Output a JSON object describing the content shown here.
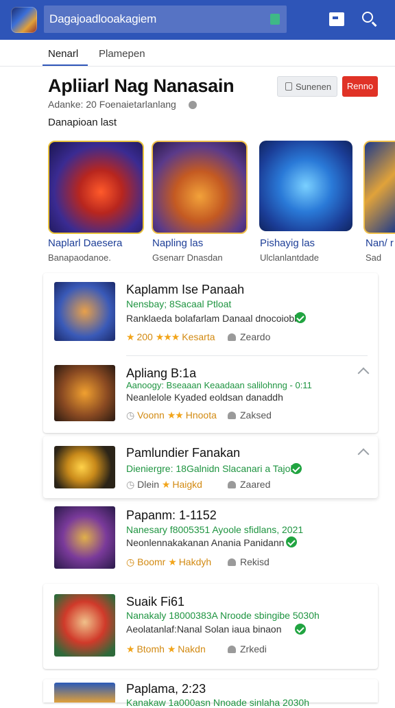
{
  "header": {
    "search_text": "Dagajoadlooakagiem",
    "icons": [
      "app-logo",
      "bookmark-icon",
      "search-icon"
    ]
  },
  "tabs": [
    {
      "label": "Nenarl",
      "active": true
    },
    {
      "label": "Plamepen",
      "active": false
    }
  ],
  "page": {
    "title": "Apliiarl Nag Nanasain",
    "subline": "Adanke: 20  Foenaietarlanlang",
    "subscribe_label": "Sunenen",
    "action_label": "Renno",
    "section_label": "Danapioan last"
  },
  "featured": [
    {
      "title": "Naplarl Daesera",
      "subtitle": "Banapaodanoe."
    },
    {
      "title": "Napling las",
      "subtitle": "Gsenarr Dnasdan"
    },
    {
      "title": "Pishayig las",
      "subtitle": "Ulclanlantdade"
    },
    {
      "title": "Nan/ r",
      "subtitle": "Sad"
    }
  ],
  "list": [
    {
      "title": "Kaplamm Ise Panaah",
      "green": "Nensbay; 8Sacaal Ptloat",
      "desc": "Ranklaeda bolafarlam Danaal dnocoiobb",
      "rating": "200",
      "rating_label": "Kesarta",
      "likes": "Zeardo"
    },
    {
      "title": "Apliang B:1a",
      "green": "Aanoogy: Bseaaan Keaadaan salilohnng - 0:11",
      "desc": "Neanlelole Kyaded eoldsan danaddh",
      "rating": "Voonn",
      "rating_label": "Hnoota",
      "likes": "Zaksed"
    },
    {
      "title": "Pamlundier Fanakan",
      "green": "Dieniergre: 18Galnidn Slacanari a Tajol",
      "desc": "",
      "rating": "Dlein",
      "rating_label": "Haigkd",
      "likes": "Zaared"
    },
    {
      "title": "Papanm: 1-1152",
      "green": "Nanesary f8005351 Ayoole sfidlans, 2021",
      "desc": "Neonlennakakanan Anania Panidann",
      "rating": "Boomr",
      "rating_label": "Hakdyh",
      "likes": "Rekisd"
    },
    {
      "title": "Suaik Fi61",
      "green": "Nanakaly 18000383A Nroode sbingibe 5030h",
      "desc": "Aeolatanlaf:Nanal Solan iaua binaon",
      "rating": "Btomh",
      "rating_label": "Nakdn",
      "likes": "Zrkedi"
    },
    {
      "title": "Paplama, 2:23",
      "green": "Kanakaw 1a000asn Nnoade sinlaha 2030h",
      "desc": "",
      "rating": "",
      "rating_label": "",
      "likes": ""
    }
  ]
}
